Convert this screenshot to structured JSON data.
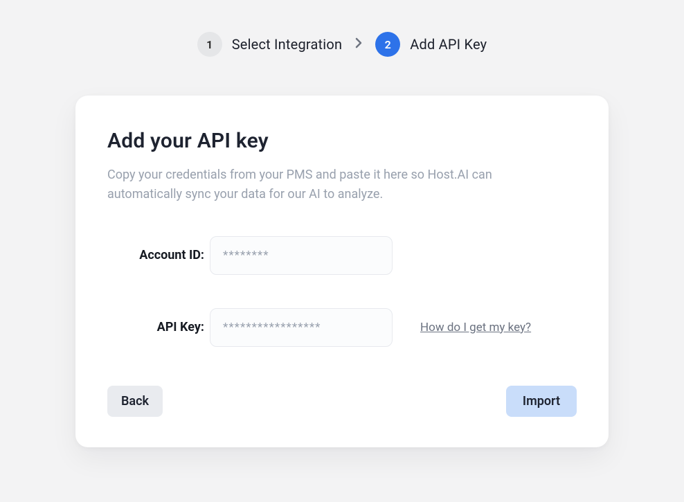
{
  "stepper": {
    "steps": [
      {
        "number": "1",
        "label": "Select Integration",
        "active": false
      },
      {
        "number": "2",
        "label": "Add API Key",
        "active": true
      }
    ]
  },
  "card": {
    "title": "Add your API key",
    "description": "Copy your credentials from your PMS and paste it here so Host.AI can automatically sync your data for our AI to analyze."
  },
  "form": {
    "account_id": {
      "label": "Account ID:",
      "placeholder": "********",
      "value": ""
    },
    "api_key": {
      "label": "API Key:",
      "placeholder": "*****************",
      "value": ""
    },
    "help_link_text": "How do I get my key?"
  },
  "actions": {
    "back_label": "Back",
    "import_label": "Import"
  },
  "colors": {
    "accent": "#2d72e9"
  }
}
